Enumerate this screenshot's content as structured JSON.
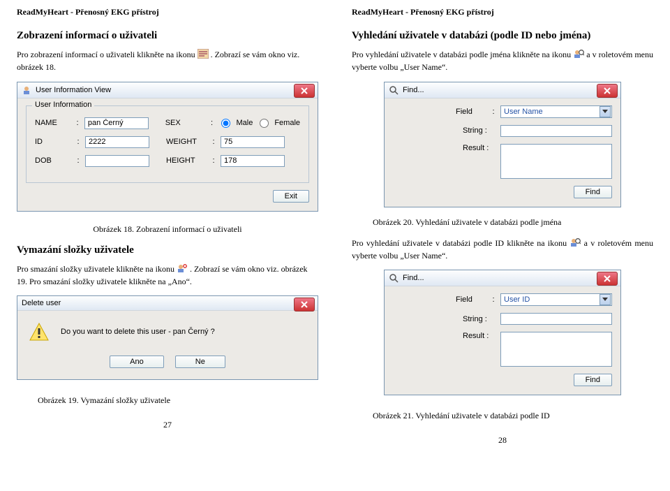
{
  "running_head": "ReadMyHeart - Přenosný EKG přístroj",
  "left": {
    "section1_title": "Zobrazení informací o uživateli",
    "section1_body_a": "Pro zobrazení informací o uživateli klikněte na ikonu ",
    "section1_body_b": ". Zobrazí se vám okno viz. obrázek 18.",
    "fig18_caption": "Obrázek 18. Zobrazení informací o uživateli",
    "section2_title": "Vymazání složky uživatele",
    "section2_body_a": "Pro smazání složky uživatele klikněte na ikonu ",
    "section2_body_b": ". Zobrazí se vám okno viz. obrázek 19. Pro smazání složky uživatele klikněte na „Ano“.",
    "fig19_caption": "Obrázek 19. Vymazání složky uživatele",
    "page_num": "27"
  },
  "right": {
    "section1_title": "Vyhledání uživatele v databázi (podle ID nebo jména)",
    "section1_body_a": "Pro vyhledání uživatele v databázi podle jména klikněte na ikonu ",
    "section1_body_b": " a v roletovém menu vyberte volbu „User Name“.",
    "fig20_caption": "Obrázek 20. Vyhledání uživatele v databázi podle jména",
    "section2_body_a": "Pro vyhledání uživatele v databázi podle ID klikněte na ikonu ",
    "section2_body_b": " a v roletovém menu vyberte volbu „User Name“.",
    "fig21_caption": "Obrázek 21. Vyhledání uživatele v databázi podle ID",
    "page_num": "28"
  },
  "dlg_userinfo": {
    "title": "User Information View",
    "group": "User Information",
    "name_lbl": "NAME",
    "name_val": "pan Černý",
    "sex_lbl": "SEX",
    "male": "Male",
    "female": "Female",
    "id_lbl": "ID",
    "id_val": "2222",
    "weight_lbl": "WEIGHT",
    "weight_val": "75",
    "dob_lbl": "DOB",
    "height_lbl": "HEIGHT",
    "height_val": "178",
    "exit": "Exit"
  },
  "dlg_delete": {
    "title": "Delete user",
    "msg": "Do you want to delete this user - pan Černý ?",
    "yes": "Ano",
    "no": "Ne"
  },
  "dlg_find_name": {
    "title": "Find...",
    "field_lbl": "Field",
    "field_val": "User Name",
    "string_lbl": "String :",
    "result_lbl": "Result :",
    "find": "Find"
  },
  "dlg_find_id": {
    "title": "Find...",
    "field_lbl": "Field",
    "field_val": "User ID",
    "string_lbl": "String :",
    "result_lbl": "Result :",
    "find": "Find"
  }
}
